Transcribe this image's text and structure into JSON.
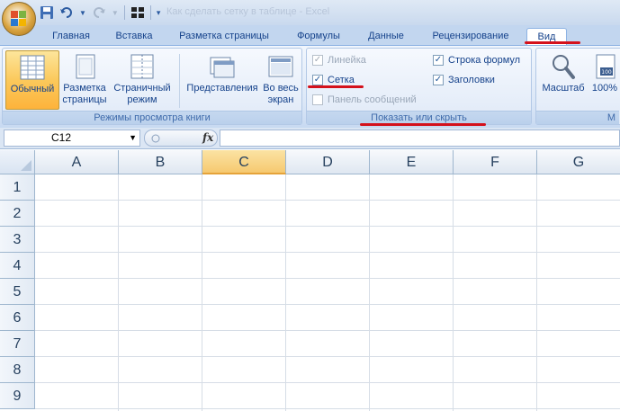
{
  "titlebar": {
    "title": "Как сделать сетку в таблице - Excel"
  },
  "tabs": [
    {
      "label": "Главная"
    },
    {
      "label": "Вставка"
    },
    {
      "label": "Разметка страницы"
    },
    {
      "label": "Формулы"
    },
    {
      "label": "Данные"
    },
    {
      "label": "Рецензирование"
    },
    {
      "label": "Вид"
    }
  ],
  "groups": {
    "views": {
      "title": "Режимы просмотра книги",
      "normal": "Обычный",
      "page_layout_1": "Разметка",
      "page_layout_2": "страницы",
      "page_break_1": "Страничный",
      "page_break_2": "режим",
      "custom_views": "Представления",
      "fullscreen_1": "Во весь",
      "fullscreen_2": "экран"
    },
    "show_hide": {
      "title": "Показать или скрыть",
      "ruler": "Линейка",
      "gridlines": "Сетка",
      "message_bar": "Панель сообщений",
      "formula_bar": "Строка формул",
      "headings": "Заголовки",
      "check": "✓"
    },
    "zoom": {
      "zoom": "Масштаб",
      "zoom100": "100%",
      "zoom100_icon_text": "100",
      "title": "М"
    }
  },
  "formula_bar": {
    "cell_ref": "C12",
    "fx": "fx",
    "value": ""
  },
  "grid": {
    "columns": [
      "A",
      "B",
      "C",
      "D",
      "E",
      "F",
      "G"
    ],
    "rows": [
      "1",
      "2",
      "3",
      "4",
      "5",
      "6",
      "7",
      "8",
      "9"
    ],
    "active_column": "C"
  },
  "colors": {
    "highlight": "#d4111b",
    "selected_button": "#fbc95c"
  }
}
